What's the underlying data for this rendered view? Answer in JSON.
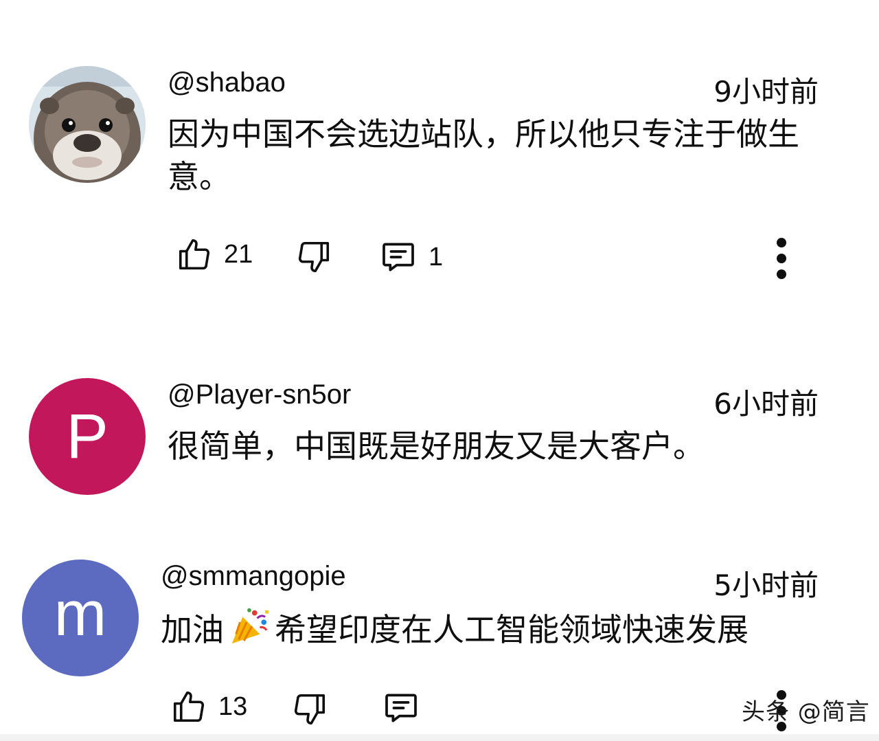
{
  "comments": [
    {
      "username": "@shabao",
      "time": "9小时前",
      "text": "因为中国不会选边站队，所以他只专注于做生意。",
      "likes": "21",
      "replies": "1",
      "avatar": {
        "type": "photo",
        "subject": "otter"
      }
    },
    {
      "username": "@Player-sn5or",
      "time": "6小时前",
      "text": "很简单，中国既是好朋友又是大客户。",
      "avatar": {
        "type": "letter",
        "letter": "P",
        "color": "#c2185b"
      }
    },
    {
      "username": "@smmangopie",
      "time": "5小时前",
      "text_before": "加油",
      "emoji": "party-popper",
      "text_after": "希望印度在人工智能领域快速发展",
      "likes": "13",
      "avatar": {
        "type": "letter",
        "letter": "m",
        "color": "#5c6bc0"
      }
    }
  ],
  "icons": {
    "like": "thumbs-up-icon",
    "dislike": "thumbs-down-icon",
    "reply": "comment-icon",
    "more": "more-vertical-icon"
  },
  "watermark": "头条 @简言"
}
